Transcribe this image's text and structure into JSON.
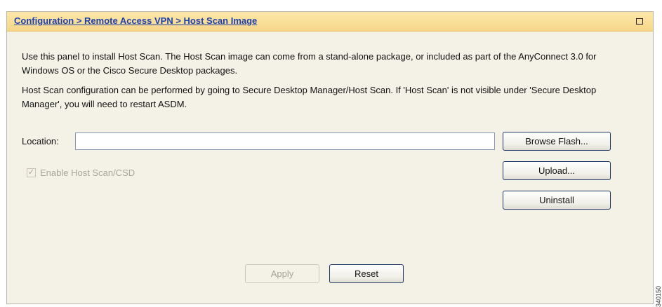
{
  "header": {
    "breadcrumb": "Configuration > Remote Access VPN > Host Scan Image"
  },
  "description": {
    "paragraph1": "Use this panel to install Host Scan. The Host Scan image can come from a stand-alone package, or included as part of the AnyConnect 3.0 for Windows OS or the Cisco Secure Desktop packages.",
    "paragraph2": "Host Scan configuration can be performed by going to Secure Desktop Manager/Host Scan. If 'Host Scan' is not visible under 'Secure Desktop Manager', you will need to restart ASDM."
  },
  "location": {
    "label": "Location:",
    "value": ""
  },
  "enable_host_scan": {
    "label": "Enable Host Scan/CSD",
    "checked": true,
    "enabled": false
  },
  "buttons": {
    "browse_flash": "Browse Flash...",
    "upload": "Upload...",
    "uninstall": "Uninstall",
    "apply": "Apply",
    "reset": "Reset"
  },
  "figure_id": "340150"
}
